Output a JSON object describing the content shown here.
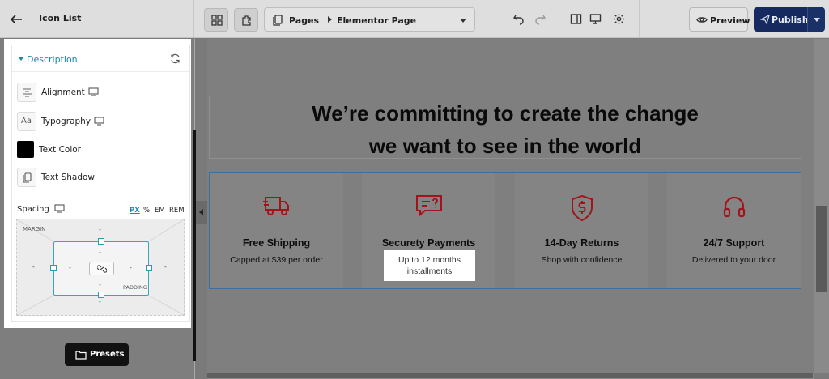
{
  "header": {
    "page_title": "Icon List",
    "pages_label": "Pages",
    "page_name": "Elementor Page",
    "preview_label": "Preview",
    "publish_label": "Publish"
  },
  "panel": {
    "section_title": "Description",
    "alignment_label": "Alignment",
    "typography_label": "Typography",
    "typography_icon_text": "Aa",
    "text_color_label": "Text Color",
    "text_color_value": "#000000",
    "text_shadow_label": "Text Shadow",
    "spacing_label": "Spacing",
    "units": [
      "PX",
      "%",
      "EM",
      "REM"
    ],
    "selected_unit": "PX",
    "margin_label": "MARGIN",
    "padding_label": "PADDING",
    "empty_value": "-"
  },
  "presets_label": "Presets",
  "canvas": {
    "heading_line1": "We’re committing to create the change",
    "heading_line2": "we want to see in the world",
    "features": [
      {
        "icon": "truck-icon",
        "title": "Free Shipping",
        "subtitle": "Capped at $39 per order"
      },
      {
        "icon": "chat-question-icon",
        "title": "Securety Payments",
        "subtitle": "Up to 12 months installments"
      },
      {
        "icon": "shield-dollar-icon",
        "title": "14-Day Returns",
        "subtitle": "Shop with confidence"
      },
      {
        "icon": "headphones-icon",
        "title": "24/7 Support",
        "subtitle": "Delivered to your door"
      }
    ],
    "tooltip_line1": "Up to 12 months",
    "tooltip_line2": "installments"
  },
  "colors": {
    "accent": "#1b8aa8",
    "publish": "#162a5f",
    "icon_red": "#a3141a"
  }
}
